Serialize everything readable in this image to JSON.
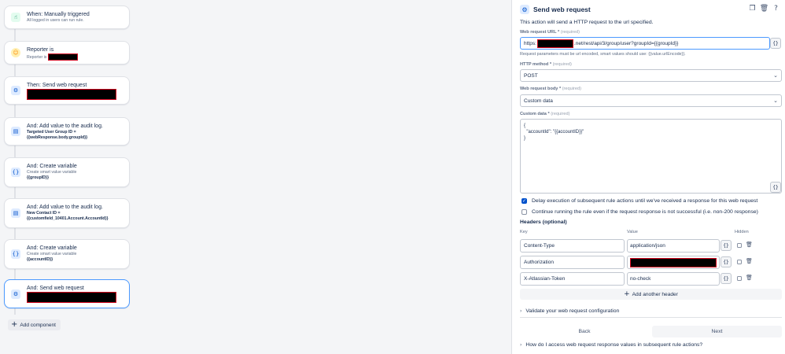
{
  "rule": {
    "components": [
      {
        "title": "When: Manually triggered",
        "sub": "All logged in users can run rule.",
        "bold": "",
        "icon": "hand-pointer-icon"
      },
      {
        "title": "Reporter is",
        "sub": "Reporter is",
        "bold": "",
        "icon": "user-condition-icon"
      },
      {
        "title": "Then: Send web request",
        "sub": "",
        "bold": "",
        "icon": "webhook-icon"
      },
      {
        "title": "And: Add value to the audit log.",
        "sub": "",
        "bold": "Targeted User Group ID = {{webResponse.body.groupId}}",
        "icon": "audit-log-icon"
      },
      {
        "title": "And: Create variable",
        "sub": "Create smart value variable",
        "bold": "{{groupID}}",
        "icon": "variable-braces-icon"
      },
      {
        "title": "And: Add value to the audit log.",
        "sub": "",
        "bold": "New Contact ID = {{customfield_10401.Account.AccountId}}",
        "icon": "audit-log-icon"
      },
      {
        "title": "And: Create variable",
        "sub": "Create smart value variable",
        "bold": "{{accountID}}",
        "icon": "variable-braces-icon"
      },
      {
        "title": "And: Send web request",
        "sub": "",
        "bold": "",
        "icon": "webhook-icon"
      }
    ],
    "add_component_label": "Add component"
  },
  "panel": {
    "title": "Send web request",
    "description": "This action will send a HTTP request to the url specified.",
    "url_label": "Web request URL",
    "required_text": "(required)",
    "url_prefix": "https:",
    "url_suffix": ".net/rest/api/3/group/user?groupId={{groupId}}",
    "url_hint": "Request parameters must be url encoded, smart values should use: {{value.urlEncode}}.",
    "method_label": "HTTP method",
    "method_value": "POST",
    "body_label": "Web request body",
    "body_value": "Custom data",
    "custom_label": "Custom data",
    "custom_value": "{\n  \"accountId\": \"{{accountID}}\"\n}",
    "brace_text": "{}",
    "checkbox_delay": "Delay execution of subsequent rule actions until we've received a response for this web request",
    "checkbox_continue": "Continue running the rule even if the request response is not successful (i.e. non-200 response)",
    "headers_title": "Headers (optional)",
    "col_key": "Key",
    "col_value": "Value",
    "col_hidden": "Hidden",
    "headers": [
      {
        "key": "Content-Type",
        "value": "application/json"
      },
      {
        "key": "Authorization",
        "value": ""
      },
      {
        "key": "X-Atlassian-Token",
        "value": "no-check"
      }
    ],
    "add_header": "Add another header",
    "validate": "Validate your web request configuration",
    "back": "Back",
    "next": "Next",
    "faq": "How do I access web request response values in subsequent rule actions?"
  }
}
